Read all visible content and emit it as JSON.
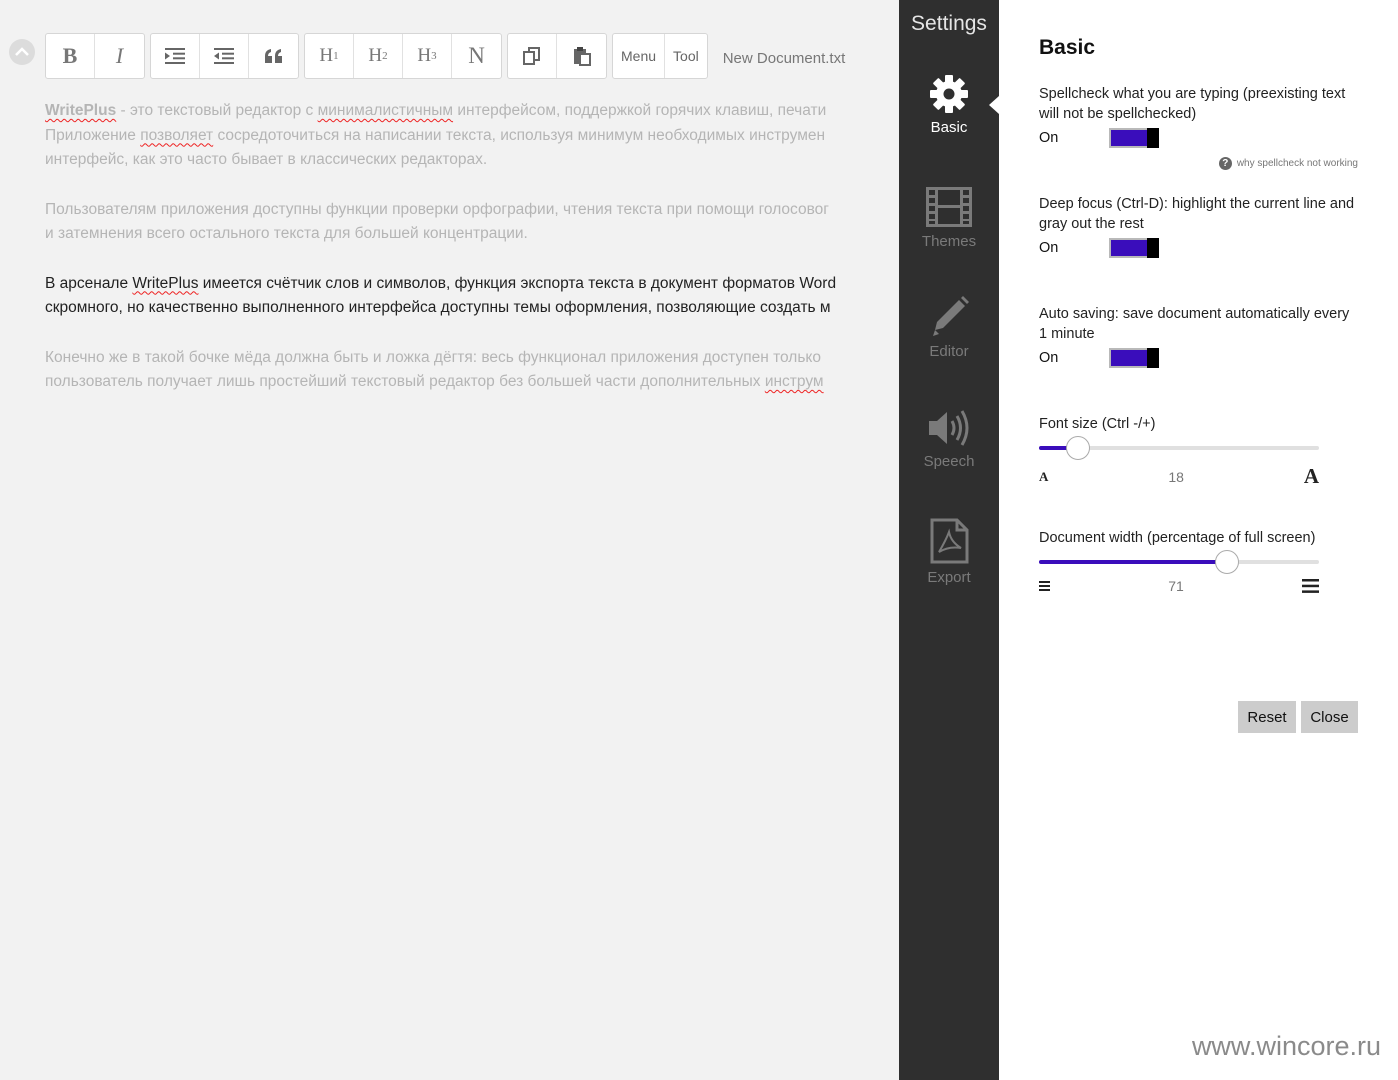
{
  "editor": {
    "toolbar": {
      "bold": "B",
      "italic": "I",
      "h1": "H",
      "h1_sub": "1",
      "h2": "H",
      "h2_sub": "2",
      "h3": "H",
      "h3_sub": "3",
      "normal": "N",
      "menu_label": "Menu",
      "tool_label": "Tool"
    },
    "document_title": "New Document.txt",
    "paragraphs": [
      {
        "lines": [
          [
            "WritePlus",
            " - это текстовый редактор с ",
            "минималистичным",
            " интерфейсом, поддержкой горячих клавиш, печати"
          ],
          [
            "Приложение ",
            "позволяет",
            " сосредоточиться на написании текста, используя минимум необходимых инструмен"
          ],
          [
            "интерфейс, как это часто бывает в классических редакторах."
          ]
        ]
      },
      {
        "lines": [
          [
            "Пользователям приложения доступны функции проверки орфографии, чтения текста при помощи голосовог"
          ],
          [
            "и затемнения всего остального текста для большей концентрации."
          ]
        ]
      },
      {
        "lines": [
          [
            "В арсенале ",
            "WritePlus",
            " имеется счётчик слов и символов, функция экспорта текста в документ форматов Word"
          ],
          [
            "скромного, но качественно выполненного интерфейса доступны темы оформления, позволяющие создать м"
          ]
        ]
      },
      {
        "lines": [
          [
            "Конечно же в такой бочке мёда должна быть и ложка дёгтя: весь функционал приложения доступен только"
          ],
          [
            "пользователь получает лишь простейший текстовый редактор без большей части дополнительных ",
            "инструм"
          ]
        ]
      }
    ]
  },
  "sidebar": {
    "title": "Settings",
    "items": [
      {
        "label": "Basic",
        "icon": "gear-icon",
        "active": true
      },
      {
        "label": "Themes",
        "icon": "film-icon",
        "active": false
      },
      {
        "label": "Editor",
        "icon": "pencil-icon",
        "active": false
      },
      {
        "label": "Speech",
        "icon": "speaker-icon",
        "active": false
      },
      {
        "label": "Export",
        "icon": "pdf-icon",
        "active": false
      }
    ]
  },
  "panel": {
    "title": "Basic",
    "spellcheck": {
      "label": "Spellcheck what you are typing (preexisting text will not be spellchecked)",
      "state": "On",
      "help": "why spellcheck not working"
    },
    "deep_focus": {
      "label": "Deep focus (Ctrl-D): highlight the current line and gray out the rest",
      "state": "On"
    },
    "auto_saving": {
      "label": "Auto saving: save document automatically every 1 minute",
      "state": "On"
    },
    "font_size": {
      "label": "Font size (Ctrl -/+)",
      "value": "18",
      "fraction": 0.14,
      "min_glyph": "A",
      "max_glyph": "A"
    },
    "doc_width": {
      "label": "Document width (percentage of full screen)",
      "value": "71",
      "fraction": 0.67
    },
    "reset_label": "Reset",
    "close_label": "Close"
  },
  "colors": {
    "accent": "#3a0dbb",
    "sidebar_bg": "#2f2f2f",
    "editor_bg": "#f2f2f2"
  },
  "watermark": "www.wincore.ru"
}
